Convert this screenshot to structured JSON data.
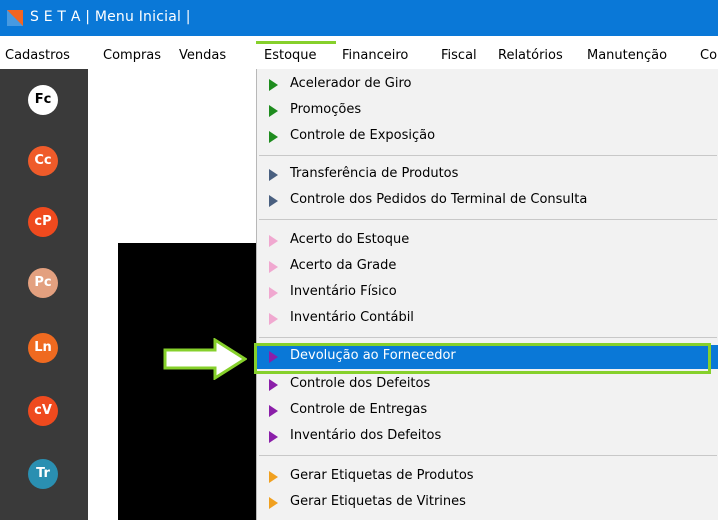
{
  "window": {
    "title": "S E T A | Menu Inicial |"
  },
  "menubar": {
    "items": [
      "Cadastros",
      "Compras",
      "Vendas",
      "Estoque",
      "Financeiro",
      "Fiscal",
      "Relatórios",
      "Manutenção",
      "Co"
    ],
    "active": "Estoque"
  },
  "sidebar": {
    "buttons": [
      {
        "label": "Fc",
        "color": "#ffffff"
      },
      {
        "label": "Cc",
        "color": "#ef5b2a"
      },
      {
        "label": "cP",
        "color": "#ef4a1e"
      },
      {
        "label": "Pc",
        "color": "#e3a07f"
      },
      {
        "label": "Ln",
        "color": "#ef6a20"
      },
      {
        "label": "cV",
        "color": "#ef4a1e"
      },
      {
        "label": "Tr",
        "color": "#2a8fb1"
      }
    ]
  },
  "estoque_menu": {
    "groups": [
      {
        "arrow_color": "#1e8c1e",
        "items": [
          "Acelerador de Giro",
          "Promoções",
          "Controle de Exposição"
        ]
      },
      {
        "arrow_color": "#4a6080",
        "items": [
          "Transferência de Produtos",
          "Controle dos Pedidos do Terminal de Consulta"
        ]
      },
      {
        "arrow_color": "#f0a8d0",
        "items": [
          "Acerto do Estoque",
          "Acerto da Grade",
          "Inventário Físico",
          "Inventário Contábil"
        ]
      },
      {
        "arrow_color": "#8b1fa9",
        "items": [
          "Devolução ao Fornecedor",
          "Controle dos Defeitos",
          "Controle de Entregas",
          "Inventário dos Defeitos"
        ]
      },
      {
        "arrow_color": "#f0a020",
        "items": [
          "Gerar Etiquetas de Produtos",
          "Gerar Etiquetas de Vitrines"
        ]
      }
    ],
    "selected": "Devolução ao Fornecedor"
  },
  "annotations": {
    "highlight_color": "#86d02b"
  }
}
